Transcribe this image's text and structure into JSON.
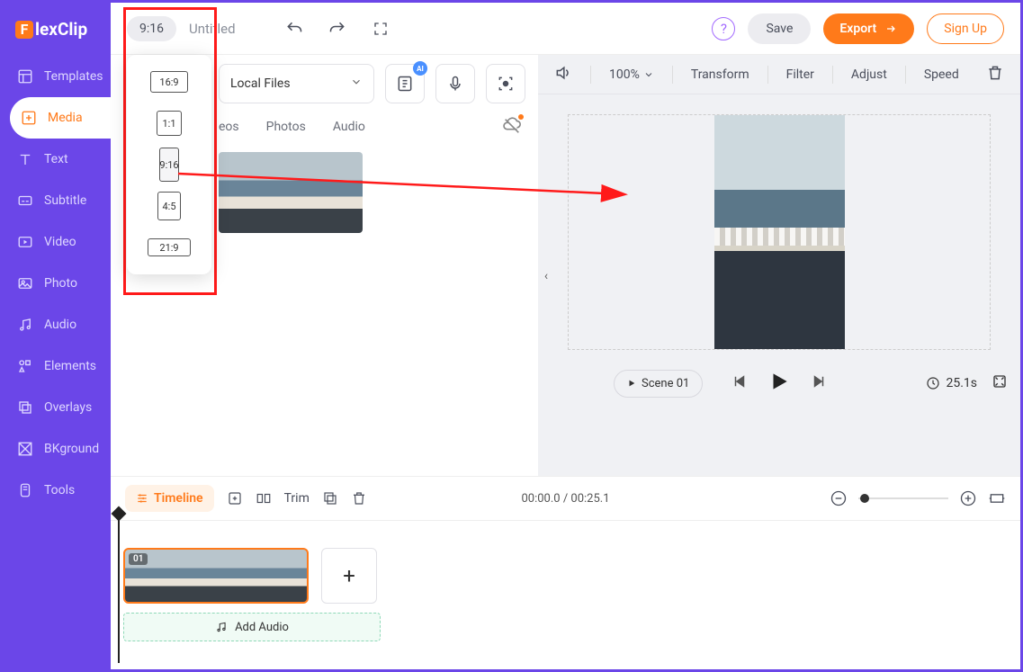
{
  "logo": "lexClip",
  "sidebar": {
    "items": [
      {
        "label": "Templates"
      },
      {
        "label": "Media"
      },
      {
        "label": "Text"
      },
      {
        "label": "Subtitle"
      },
      {
        "label": "Video"
      },
      {
        "label": "Photo"
      },
      {
        "label": "Audio"
      },
      {
        "label": "Elements"
      },
      {
        "label": "Overlays"
      },
      {
        "label": "BKground"
      },
      {
        "label": "Tools"
      }
    ]
  },
  "topbar": {
    "ratio": "9:16",
    "title": "Untitled",
    "save": "Save",
    "export": "Export",
    "signup": "Sign Up"
  },
  "aspect_options": [
    "16:9",
    "1:1",
    "9:16",
    "4:5",
    "21:9"
  ],
  "panel": {
    "local_files": "Local Files",
    "ai_badge": "AI",
    "tabs": {
      "videos": "eos",
      "photos": "Photos",
      "audio": "Audio"
    }
  },
  "preview": {
    "zoom": "100%",
    "transform": "Transform",
    "filter": "Filter",
    "adjust": "Adjust",
    "speed": "Speed",
    "scene": "Scene 01",
    "duration": "25.1s"
  },
  "timeline_bar": {
    "label": "Timeline",
    "trim": "Trim",
    "time": "00:00.0 / 00:25.1"
  },
  "timeline": {
    "clip_num": "01",
    "add_audio": "Add Audio"
  }
}
